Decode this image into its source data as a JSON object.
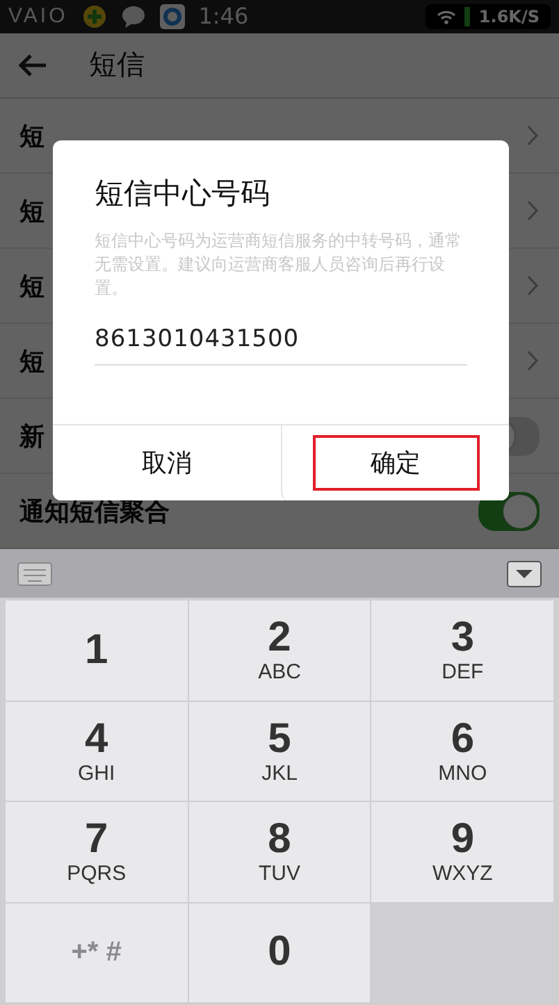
{
  "status_bar": {
    "logo": "VAIO",
    "time": "1:46",
    "speed": "1.6K/S"
  },
  "app_bar": {
    "title": "短信"
  },
  "settings": [
    {
      "label": "短",
      "kind": "link"
    },
    {
      "label": "短",
      "kind": "link"
    },
    {
      "label": "短",
      "kind": "link"
    },
    {
      "label": "短",
      "kind": "link"
    },
    {
      "label": "新",
      "kind": "toggle",
      "on": false
    },
    {
      "label": "通知短信聚合",
      "kind": "toggle",
      "on": true
    }
  ],
  "dialog": {
    "title": "短信中心号码",
    "description": "短信中心号码为运营商短信服务的中转号码，通常无需设置。建议向运营商客服人员咨询后再行设置。",
    "value": "8613010431500",
    "buttons": [
      {
        "label": "取消",
        "highlighted": false
      },
      {
        "label": "确定",
        "highlighted": true
      }
    ]
  },
  "keypad": [
    {
      "digit": "1"
    },
    {
      "digit": "2",
      "letters": "ABC"
    },
    {
      "digit": "3",
      "letters": "DEF"
    },
    {
      "digit": "4",
      "letters": "GHI"
    },
    {
      "digit": "5",
      "letters": "JKL"
    },
    {
      "digit": "6",
      "letters": "MNO"
    },
    {
      "digit": "7",
      "letters": "PQRS"
    },
    {
      "digit": "8",
      "letters": "TUV"
    },
    {
      "digit": "9",
      "letters": "WXYZ"
    },
    {
      "symbols": "+* #"
    },
    {
      "digit": "0"
    }
  ]
}
